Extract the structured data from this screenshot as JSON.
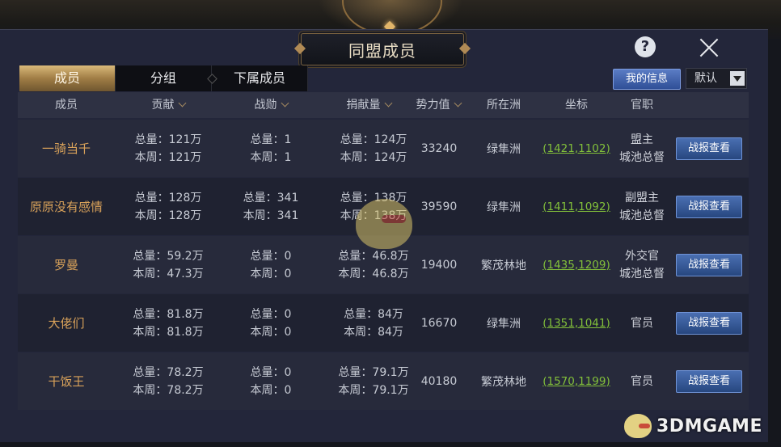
{
  "window": {
    "title": "同盟成员",
    "help_label": "?"
  },
  "tabs": [
    {
      "label": "成员",
      "active": true
    },
    {
      "label": "分组",
      "active": false
    },
    {
      "label": "下属成员",
      "active": false
    }
  ],
  "toolbar": {
    "my_info_label": "我的信息",
    "sort_value": "默认"
  },
  "table": {
    "headers": [
      "成员",
      "贡献",
      "战勋",
      "捐献量",
      "势力值",
      "所在洲",
      "坐标",
      "官职"
    ],
    "rows": [
      {
        "name": "一骑当千",
        "contrib_total": "总量：121万",
        "contrib_week": "本周：121万",
        "merit_total": "总量：1",
        "merit_week": "本周：1",
        "donate_total": "总量：124万",
        "donate_week": "本周：124万",
        "power": "33240",
        "region": "绿隼洲",
        "coord": "(1421,1102)",
        "rank_line1": "盟主",
        "rank_line2": "城池总督",
        "report_label": "战报查看"
      },
      {
        "name": "原原没有感情",
        "contrib_total": "总量：128万",
        "contrib_week": "本周：128万",
        "merit_total": "总量：341",
        "merit_week": "本周：341",
        "donate_total": "总量：138万",
        "donate_week": "本周：138万",
        "power": "39590",
        "region": "绿隼洲",
        "coord": "(1411,1092)",
        "rank_line1": "副盟主",
        "rank_line2": "城池总督",
        "report_label": "战报查看"
      },
      {
        "name": "罗曼",
        "contrib_total": "总量：59.2万",
        "contrib_week": "本周：47.3万",
        "merit_total": "总量：0",
        "merit_week": "本周：0",
        "donate_total": "总量：46.8万",
        "donate_week": "本周：46.8万",
        "power": "19400",
        "region": "繁茂林地",
        "coord": "(1435,1209)",
        "rank_line1": "外交官",
        "rank_line2": "城池总督",
        "report_label": "战报查看"
      },
      {
        "name": "大佬们",
        "contrib_total": "总量：81.8万",
        "contrib_week": "本周：81.8万",
        "merit_total": "总量：0",
        "merit_week": "本周：0",
        "donate_total": "总量：84万",
        "donate_week": "本周：84万",
        "power": "16670",
        "region": "绿隼洲",
        "coord": "(1351,1041)",
        "rank_line1": "官员",
        "rank_line2": "",
        "report_label": "战报查看"
      },
      {
        "name": "干饭王",
        "contrib_total": "总量：78.2万",
        "contrib_week": "本周：78.2万",
        "merit_total": "总量：0",
        "merit_week": "本周：0",
        "donate_total": "总量：79.1万",
        "donate_week": "本周：79.1万",
        "power": "40180",
        "region": "繁茂林地",
        "coord": "(1570,1199)",
        "rank_line1": "官员",
        "rank_line2": "",
        "report_label": "战报查看"
      }
    ]
  },
  "watermark": {
    "text": "3DMGAME"
  },
  "colors": {
    "accent_gold": "#d9a25a",
    "coord_green": "#82c03a",
    "button_blue": "#3a5fa3"
  }
}
